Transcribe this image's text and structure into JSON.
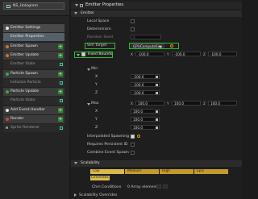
{
  "left_panel": {
    "tab_title": "NS_Hologram",
    "items": [
      {
        "label": "Emitter Settings",
        "kind": "header-settings"
      },
      {
        "label": "Emitter Properties",
        "kind": "header-props"
      },
      {
        "label": "Emitter Spawn",
        "kind": "header"
      },
      {
        "label": "Emitter Update",
        "kind": "header"
      },
      {
        "label": "Emitter State",
        "kind": "sub"
      },
      {
        "label": "Particle Spawn",
        "kind": "header"
      },
      {
        "label": "Initialize Particle",
        "kind": "sub"
      },
      {
        "label": "Particle Update",
        "kind": "header"
      },
      {
        "label": "Particle State",
        "kind": "sub"
      },
      {
        "label": "Add Event Handler",
        "kind": "header"
      },
      {
        "label": "Render",
        "kind": "header"
      },
      {
        "label": "Sprite Renderer",
        "kind": "sub"
      }
    ]
  },
  "right_panel": {
    "title": "Emitter Properties",
    "emitter_section": "Emitter",
    "local_space": "Local Space",
    "determinism": "Determinism",
    "random_seed": "Random Seed",
    "random_seed_value": "0",
    "sim_target": "Sim Target",
    "sim_target_value": "GPUComputeSim",
    "fixed_bounds": "Fixed Bounds",
    "min_label": "Min",
    "max_label": "Max",
    "min": {
      "x": "-100.0",
      "y": "-100.0",
      "z": "-100.0",
      "X": "-100.0",
      "Y": "-100.0",
      "Z": "-100.0"
    },
    "max": {
      "x": "100.0",
      "y": "100.0",
      "z": "100.0",
      "X": "100.0",
      "Y": "100.0",
      "Z": "100.0"
    },
    "axis_labels": {
      "x": "X",
      "y": "Y",
      "z": "Z"
    },
    "interpolated_spawning": "Interpolated Spawning",
    "requires_persistent_ids": "Requires Persistent ID",
    "combine_event_spawn": "Combine Event Spawn",
    "scalability_section": "Scalability",
    "scalability_levels": [
      "Low",
      "Medium",
      "High",
      "Epic"
    ],
    "cinematic": "Cinematic",
    "chm_conditions": "Chm Conditions",
    "array_elements": "0 Array elements",
    "scalability_overrides": "Scalability Overrides"
  },
  "colors": {
    "highlight": "#2ebd2e",
    "scalability": "#c59a2a"
  }
}
